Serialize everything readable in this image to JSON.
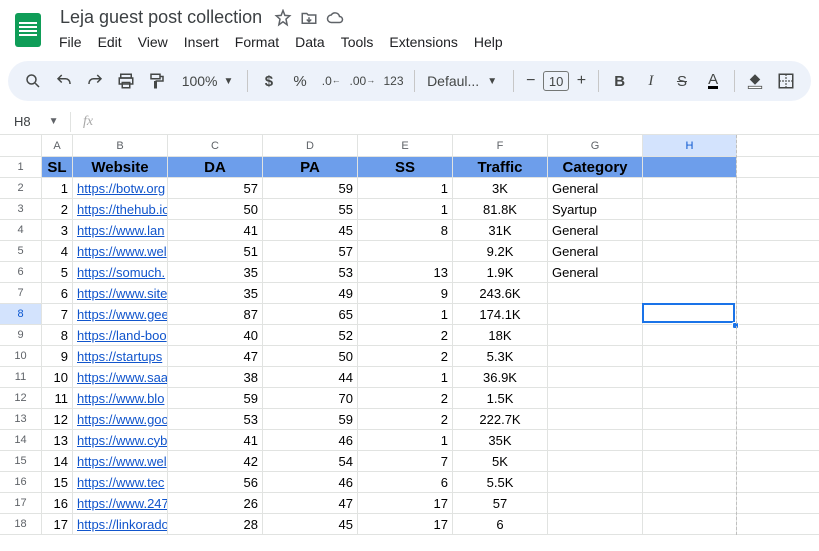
{
  "doc": {
    "title": "Leja guest post collection"
  },
  "menu": {
    "file": "File",
    "edit": "Edit",
    "view": "View",
    "insert": "Insert",
    "format": "Format",
    "data": "Data",
    "tools": "Tools",
    "extensions": "Extensions",
    "help": "Help"
  },
  "toolbar": {
    "zoom": "100%",
    "font": "Defaul...",
    "size": "10"
  },
  "namebox": {
    "value": "H8",
    "formula": ""
  },
  "cols": {
    "labels": [
      "A",
      "B",
      "C",
      "D",
      "E",
      "F",
      "G",
      "H"
    ],
    "widths": [
      31,
      95,
      95,
      95,
      95,
      95,
      95,
      94
    ],
    "selected": 7
  },
  "headerRow": {
    "cells": [
      "SL",
      "Website",
      "DA",
      "PA",
      "SS",
      "Traffic",
      "Category"
    ]
  },
  "rows": [
    {
      "sl": "1",
      "site": "https://botw.org",
      "da": "57",
      "pa": "59",
      "ss": "1",
      "traffic": "3K",
      "cat": "General"
    },
    {
      "sl": "2",
      "site": "https://thehub.io",
      "da": "50",
      "pa": "55",
      "ss": "1",
      "traffic": "81.8K",
      "cat": "Syartup"
    },
    {
      "sl": "3",
      "site": "https://www.lan",
      "da": "41",
      "pa": "45",
      "ss": "8",
      "traffic": "31K",
      "cat": "General"
    },
    {
      "sl": "4",
      "site": "https://www.wel",
      "da": "51",
      "pa": "57",
      "ss": "",
      "traffic": "9.2K",
      "cat": "General"
    },
    {
      "sl": "5",
      "site": "https://somuch.",
      "da": "35",
      "pa": "53",
      "ss": "13",
      "traffic": "1.9K",
      "cat": "General"
    },
    {
      "sl": "6",
      "site": "https://www.site",
      "da": "35",
      "pa": "49",
      "ss": "9",
      "traffic": "243.6K",
      "cat": ""
    },
    {
      "sl": "7",
      "site": "https://www.gee",
      "da": "87",
      "pa": "65",
      "ss": "1",
      "traffic": "174.1K",
      "cat": ""
    },
    {
      "sl": "8",
      "site": "https://land-boo",
      "da": "40",
      "pa": "52",
      "ss": "2",
      "traffic": "18K",
      "cat": ""
    },
    {
      "sl": "9",
      "site": "https://startups",
      "da": "47",
      "pa": "50",
      "ss": "2",
      "traffic": "5.3K",
      "cat": ""
    },
    {
      "sl": "10",
      "site": "https://www.saa",
      "da": "38",
      "pa": "44",
      "ss": "1",
      "traffic": "36.9K",
      "cat": ""
    },
    {
      "sl": "11",
      "site": "https://www.blo",
      "da": "59",
      "pa": "70",
      "ss": "2",
      "traffic": "1.5K",
      "cat": ""
    },
    {
      "sl": "12",
      "site": "https://www.goo",
      "da": "53",
      "pa": "59",
      "ss": "2",
      "traffic": "222.7K",
      "cat": ""
    },
    {
      "sl": "13",
      "site": "https://www.cyb",
      "da": "41",
      "pa": "46",
      "ss": "1",
      "traffic": "35K",
      "cat": ""
    },
    {
      "sl": "14",
      "site": "https://www.wel",
      "da": "42",
      "pa": "54",
      "ss": "7",
      "traffic": "5K",
      "cat": ""
    },
    {
      "sl": "15",
      "site": "https://www.tec",
      "da": "56",
      "pa": "46",
      "ss": "6",
      "traffic": "5.5K",
      "cat": ""
    },
    {
      "sl": "16",
      "site": "https://www.247",
      "da": "26",
      "pa": "47",
      "ss": "17",
      "traffic": "57",
      "cat": ""
    },
    {
      "sl": "17",
      "site": "https://linkorado",
      "da": "28",
      "pa": "45",
      "ss": "17",
      "traffic": "6",
      "cat": ""
    }
  ],
  "rowHeads": [
    "1",
    "2",
    "3",
    "4",
    "5",
    "6",
    "7",
    "8",
    "9",
    "10",
    "11",
    "12",
    "13",
    "14",
    "15",
    "16",
    "17",
    "18"
  ],
  "selectedRow": 8
}
